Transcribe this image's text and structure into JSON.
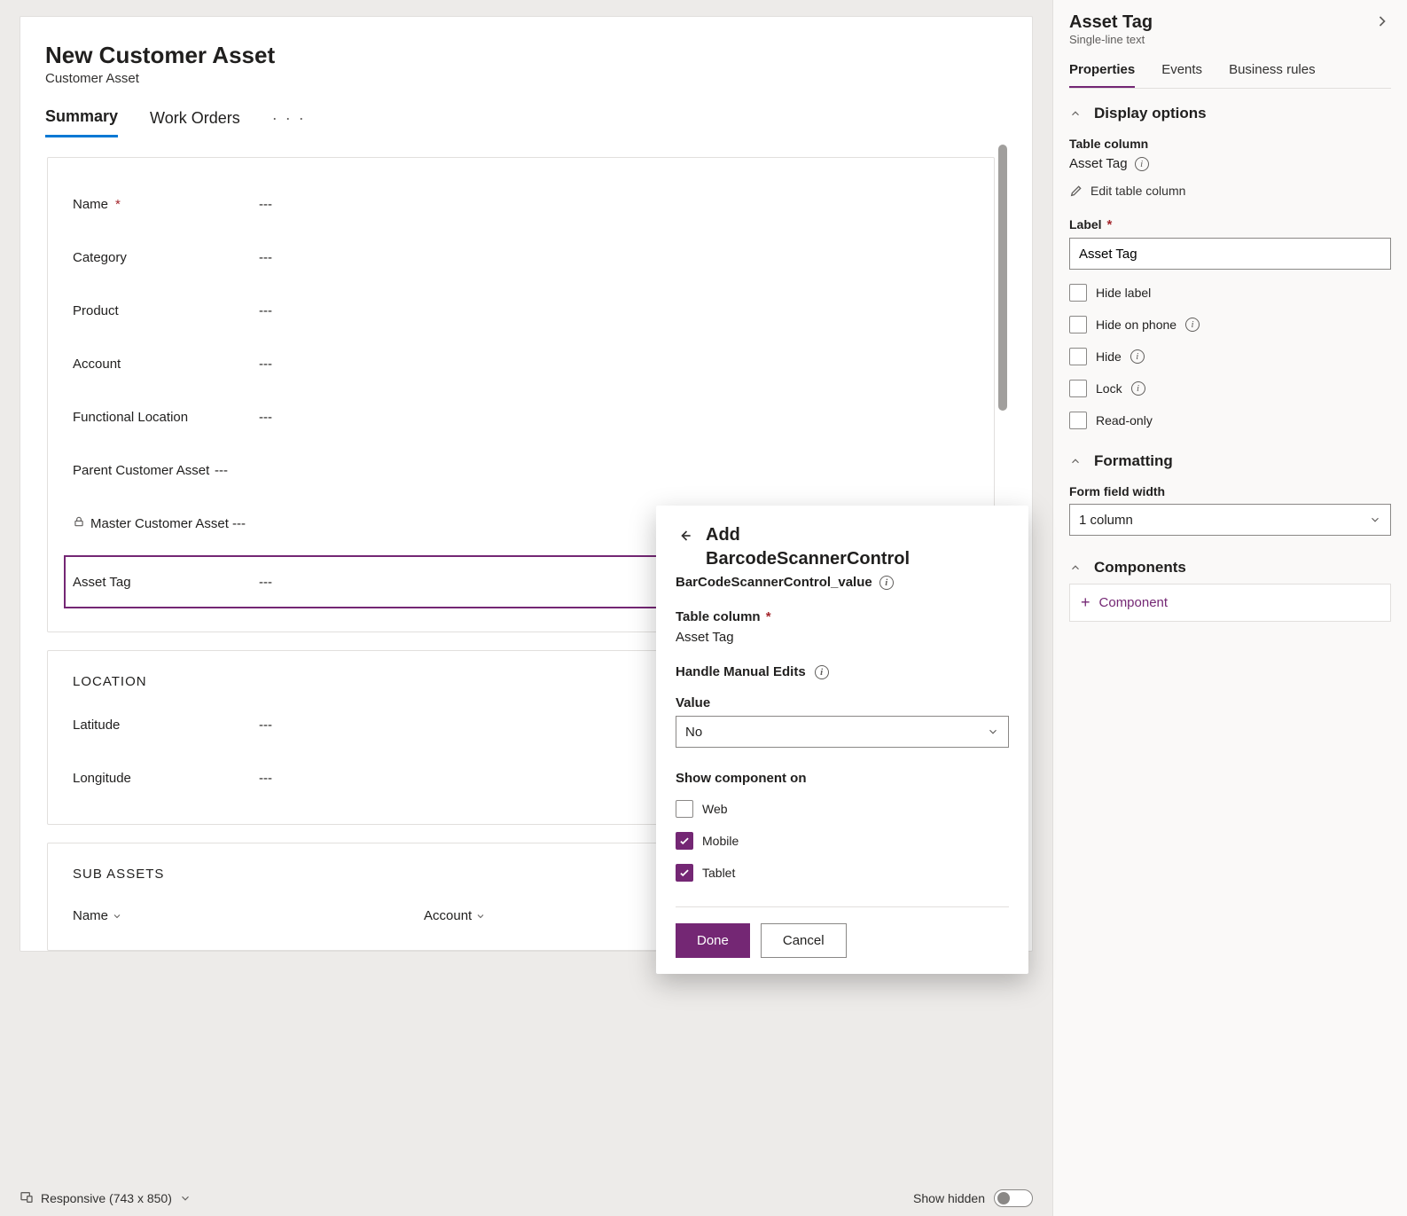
{
  "record": {
    "title": "New Customer Asset",
    "entity": "Customer Asset"
  },
  "tabs": [
    {
      "label": "Summary",
      "active": true
    },
    {
      "label": "Work Orders",
      "active": false
    }
  ],
  "overflow_glyph": "· · ·",
  "empty_value": "---",
  "general_fields": [
    {
      "name": "name",
      "label": "Name",
      "required": true,
      "locked": false,
      "value": "---"
    },
    {
      "name": "category",
      "label": "Category",
      "required": false,
      "locked": false,
      "value": "---"
    },
    {
      "name": "product",
      "label": "Product",
      "required": false,
      "locked": false,
      "value": "---"
    },
    {
      "name": "account",
      "label": "Account",
      "required": false,
      "locked": false,
      "value": "---"
    },
    {
      "name": "functional_location",
      "label": "Functional Location",
      "required": false,
      "locked": false,
      "value": "---"
    },
    {
      "name": "parent_asset",
      "label": "Parent Customer Asset",
      "required": false,
      "locked": false,
      "value": "---"
    },
    {
      "name": "master_asset",
      "label": "Master Customer Asset",
      "required": false,
      "locked": true,
      "value": "---"
    },
    {
      "name": "asset_tag",
      "label": "Asset Tag",
      "required": false,
      "locked": false,
      "value": "---",
      "selected": true
    }
  ],
  "location_section": {
    "heading": "LOCATION",
    "fields": [
      {
        "name": "latitude",
        "label": "Latitude",
        "value": "---"
      },
      {
        "name": "longitude",
        "label": "Longitude",
        "value": "---"
      }
    ]
  },
  "subassets_section": {
    "heading": "SUB ASSETS",
    "columns": [
      {
        "name": "name",
        "label": "Name"
      },
      {
        "name": "account",
        "label": "Account"
      }
    ]
  },
  "bottom_bar": {
    "mode": "Responsive (743 x 850)",
    "show_hidden_label": "Show hidden",
    "show_hidden": false
  },
  "properties_panel": {
    "title": "Asset Tag",
    "subtitle": "Single-line text",
    "tabs": [
      {
        "label": "Properties",
        "active": true
      },
      {
        "label": "Events",
        "active": false
      },
      {
        "label": "Business rules",
        "active": false
      }
    ],
    "display_options": {
      "heading": "Display options",
      "table_column_label": "Table column",
      "table_column_value": "Asset Tag",
      "edit_link": "Edit table column",
      "label_label": "Label",
      "label_value": "Asset Tag",
      "checkboxes": [
        {
          "name": "hide_label",
          "label": "Hide label",
          "info": false,
          "checked": false
        },
        {
          "name": "hide_phone",
          "label": "Hide on phone",
          "info": true,
          "checked": false
        },
        {
          "name": "hide",
          "label": "Hide",
          "info": true,
          "checked": false
        },
        {
          "name": "lock",
          "label": "Lock",
          "info": true,
          "checked": false
        },
        {
          "name": "read_only",
          "label": "Read-only",
          "info": false,
          "checked": false
        }
      ]
    },
    "formatting": {
      "heading": "Formatting",
      "width_label": "Form field width",
      "width_value": "1 column"
    },
    "components": {
      "heading": "Components",
      "add_label": "Component"
    }
  },
  "popup": {
    "title_line1": "Add",
    "title_line2": "BarcodeScannerControl",
    "subtitle": "BarCodeScannerControl_value",
    "table_column_label": "Table column",
    "table_column_value": "Asset Tag",
    "manual_edits_heading": "Handle Manual Edits",
    "value_label": "Value",
    "value_selected": "No",
    "show_on_heading": "Show component on",
    "targets": [
      {
        "name": "web",
        "label": "Web",
        "checked": false
      },
      {
        "name": "mobile",
        "label": "Mobile",
        "checked": true
      },
      {
        "name": "tablet",
        "label": "Tablet",
        "checked": true
      }
    ],
    "done_label": "Done",
    "cancel_label": "Cancel"
  }
}
